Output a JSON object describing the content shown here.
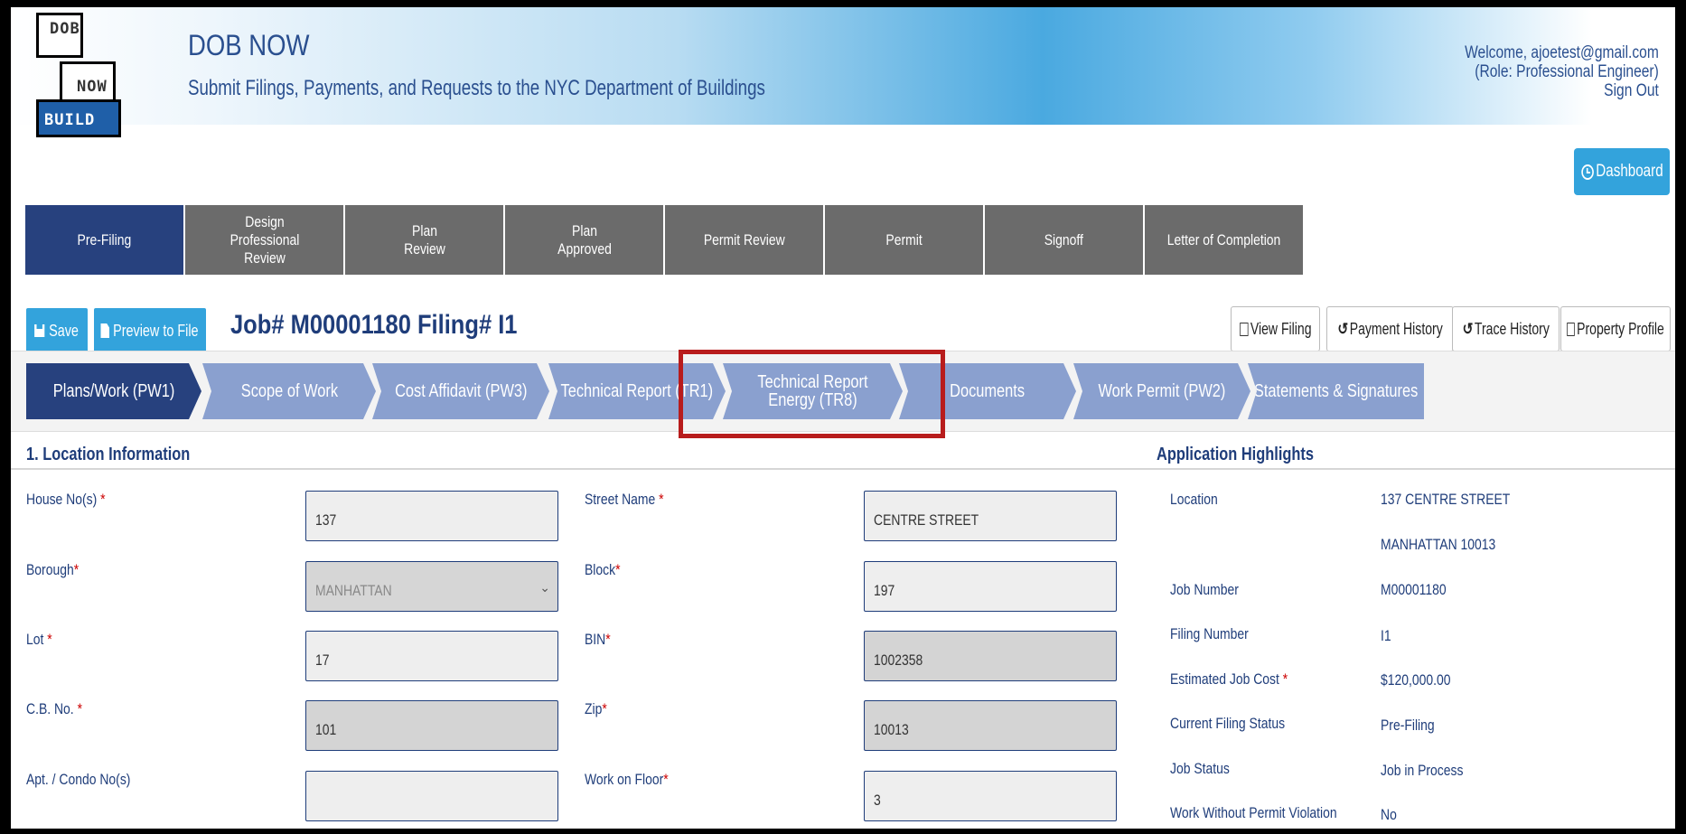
{
  "header": {
    "logo": {
      "line1": "DOB",
      "line2": "NOW",
      "line3": "BUILD"
    },
    "title": "DOB NOW",
    "subtitle": "Submit Filings, Payments, and Requests to the NYC Department of Buildings",
    "welcome": "Welcome, ajoetest@gmail.com",
    "role": "(Role: Professional Engineer)",
    "sign_out": "Sign Out"
  },
  "dashboard_label": "Dashboard",
  "stages": [
    {
      "label": "Pre-Filing"
    },
    {
      "label": "Design Professional Review"
    },
    {
      "label": "Plan Review"
    },
    {
      "label": "Plan Approved"
    },
    {
      "label": "Permit Review"
    },
    {
      "label": "Permit"
    },
    {
      "label": "Signoff"
    },
    {
      "label": "Letter of Completion"
    }
  ],
  "toolbar": {
    "save": "Save",
    "preview": "Preview to File",
    "job_title": "Job# M00001180 Filing# I1",
    "view_filing": "View Filing",
    "payment_history": "Payment History",
    "trace_history": "Trace History",
    "property_profile": "Property Profile"
  },
  "sections": [
    {
      "label": "Plans/Work (PW1)"
    },
    {
      "label": "Scope of Work"
    },
    {
      "label": "Cost Affidavit (PW3)"
    },
    {
      "label": "Technical Report (TR1)"
    },
    {
      "label": "Technical Report Energy (TR8)"
    },
    {
      "label": "Documents"
    },
    {
      "label": "Work Permit (PW2)"
    },
    {
      "label": "Statements & Signatures"
    }
  ],
  "location": {
    "heading": "1. Location Information",
    "house_label": "House No(s)",
    "house_value": "137",
    "street_label": "Street Name",
    "street_value": "CENTRE STREET",
    "borough_label": "Borough",
    "borough_value": "MANHATTAN",
    "block_label": "Block",
    "block_value": "197",
    "lot_label": "Lot",
    "lot_value": "17",
    "bin_label": "BIN",
    "bin_value": "1002358",
    "cb_label": "C.B. No.",
    "cb_value": "101",
    "zip_label": "Zip",
    "zip_value": "10013",
    "apt_label": "Apt. / Condo No(s)",
    "apt_value": "",
    "floor_label": "Work on Floor",
    "floor_value": "3"
  },
  "highlights": {
    "heading": "Application Highlights",
    "location_label": "Location",
    "location_line1": "137 CENTRE STREET",
    "location_line2": "MANHATTAN 10013",
    "job_number_label": "Job Number",
    "job_number": "M00001180",
    "filing_number_label": "Filing Number",
    "filing_number": "I1",
    "est_cost_label": "Estimated Job Cost",
    "est_cost": "$120,000.00",
    "status_label": "Current Filing Status",
    "status": "Pre-Filing",
    "job_status_label": "Job Status",
    "job_status": "Job in Process",
    "wwp_label": "Work Without Permit Violation",
    "wwp": "No"
  },
  "colors": {
    "stage_active": "#27417e",
    "stage_inactive": "#6b6b6b",
    "section_active": "#27417e",
    "section_inactive": "#8aa0cf",
    "accent_button": "#33a3dc",
    "highlight_border": "#b81c1c"
  }
}
